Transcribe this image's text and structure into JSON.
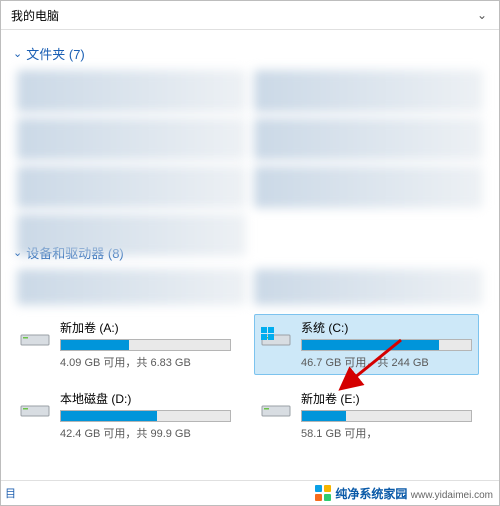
{
  "nav": {
    "crumb": "我的电脑"
  },
  "group_folders": {
    "label": "文件夹",
    "count": 7
  },
  "group_devices": {
    "label": "设备和驱动器",
    "count": 8
  },
  "drives": [
    {
      "name": "新加卷 (A:)",
      "free": "4.09 GB",
      "total": "6.83 GB",
      "fill": 40,
      "selected": false,
      "win": false
    },
    {
      "name": "系统 (C:)",
      "free": "46.7 GB",
      "total": "244 GB",
      "fill": 81,
      "selected": true,
      "win": true
    },
    {
      "name": "本地磁盘 (D:)",
      "free": "42.4 GB",
      "total": "99.9 GB",
      "fill": 57,
      "selected": false,
      "win": false
    },
    {
      "name": "新加卷 (E:)",
      "free": "58.1 GB",
      "total": "",
      "fill": 26,
      "selected": false,
      "win": false
    }
  ],
  "stat_tpl": {
    "free_label": "可用，",
    "total_prefix": "共 "
  },
  "footer": {
    "left": "目",
    "brand": "纯净系统家园",
    "site": "www.yidaimei.com"
  }
}
